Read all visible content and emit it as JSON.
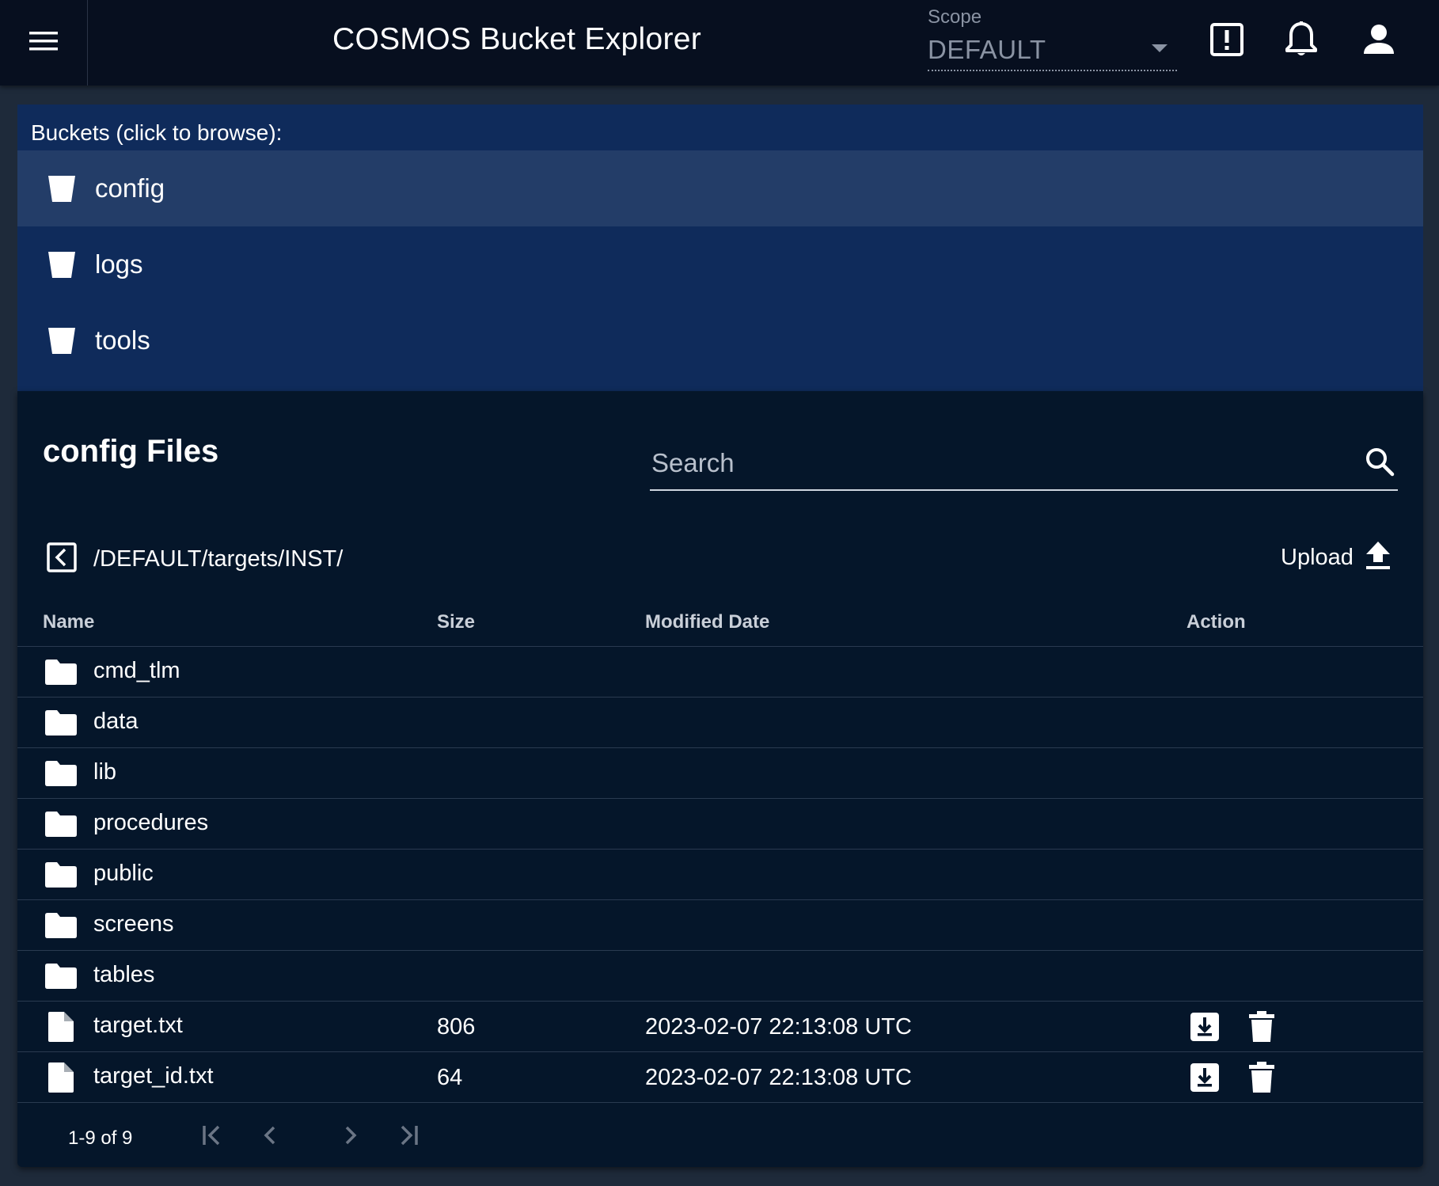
{
  "app": {
    "title": "COSMOS Bucket Explorer",
    "scope_label": "Scope",
    "scope_value": "DEFAULT"
  },
  "icons": {
    "menu": "menu-icon",
    "alert": "alert-box-icon",
    "notifications": "bell-icon",
    "account": "account-icon",
    "bucket": "bucket-icon",
    "folder": "folder-icon",
    "file": "file-icon",
    "search": "magnify-icon",
    "back": "back-arrow-box-icon",
    "upload": "upload-icon",
    "download": "download-icon",
    "delete": "trash-icon"
  },
  "buckets": {
    "heading": "Buckets (click to browse):",
    "items": [
      {
        "label": "config",
        "selected": true
      },
      {
        "label": "logs",
        "selected": false
      },
      {
        "label": "tools",
        "selected": false
      }
    ]
  },
  "files": {
    "title": "config Files",
    "search_placeholder": "Search",
    "path": "/DEFAULT/targets/INST/",
    "upload_label": "Upload",
    "columns": [
      "Name",
      "Size",
      "Modified Date",
      "Action"
    ],
    "rows": [
      {
        "type": "folder",
        "name": "cmd_tlm",
        "size": "",
        "date": ""
      },
      {
        "type": "folder",
        "name": "data",
        "size": "",
        "date": ""
      },
      {
        "type": "folder",
        "name": "lib",
        "size": "",
        "date": ""
      },
      {
        "type": "folder",
        "name": "procedures",
        "size": "",
        "date": ""
      },
      {
        "type": "folder",
        "name": "public",
        "size": "",
        "date": ""
      },
      {
        "type": "folder",
        "name": "screens",
        "size": "",
        "date": ""
      },
      {
        "type": "folder",
        "name": "tables",
        "size": "",
        "date": ""
      },
      {
        "type": "file",
        "name": "target.txt",
        "size": "806",
        "date": "2023-02-07 22:13:08 UTC"
      },
      {
        "type": "file",
        "name": "target_id.txt",
        "size": "64",
        "date": "2023-02-07 22:13:08 UTC"
      }
    ],
    "pagination": "1-9 of 9"
  },
  "colors": {
    "appbar": "#070f1f",
    "background": "#1e2a3a",
    "buckets_panel": "#0f2b5b",
    "bucket_selected": "#233d68",
    "files_card": "#05162a",
    "text": "#ffffff",
    "muted": "#8a93a3"
  }
}
